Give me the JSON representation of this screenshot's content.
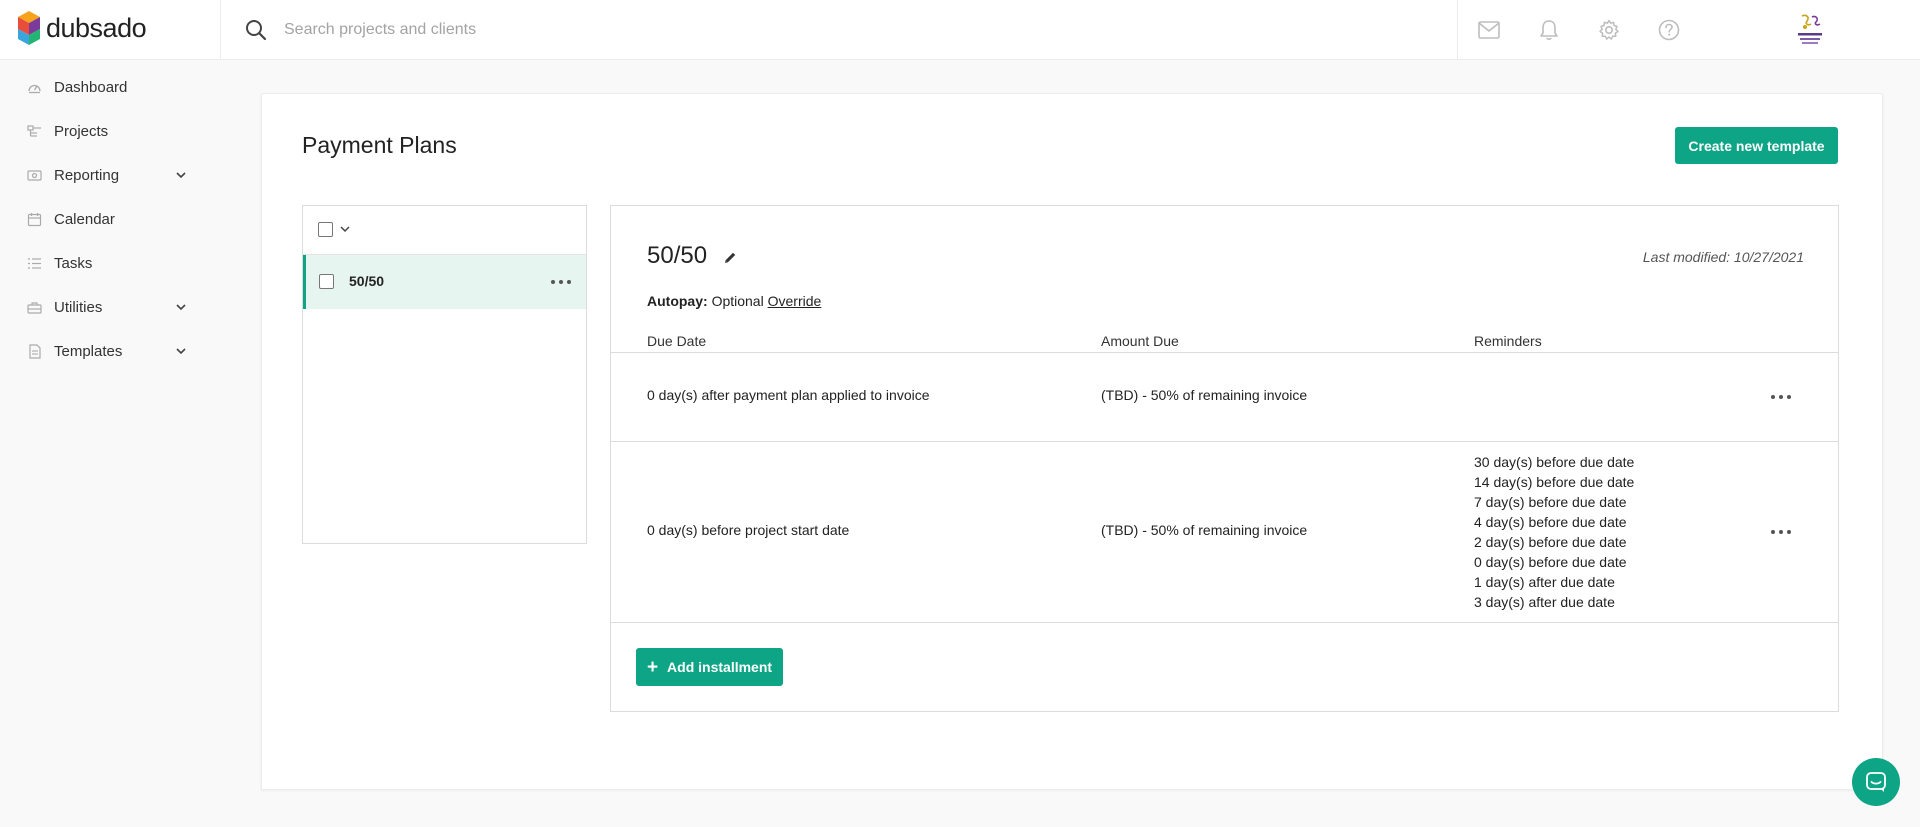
{
  "brand": {
    "name": "dubsado",
    "accent_color": "#0ea486"
  },
  "topbar": {
    "search_placeholder": "Search projects and clients",
    "icons": [
      "search-icon",
      "mail-icon",
      "bell-icon",
      "gear-icon",
      "help-icon"
    ],
    "avatar_icon": "studio-logo-avatar"
  },
  "sidebar": {
    "items": [
      {
        "label": "Dashboard",
        "icon": "dashboard-icon",
        "has_chevron": false
      },
      {
        "label": "Projects",
        "icon": "projects-icon",
        "has_chevron": false
      },
      {
        "label": "Reporting",
        "icon": "reporting-icon",
        "has_chevron": true
      },
      {
        "label": "Calendar",
        "icon": "calendar-icon",
        "has_chevron": false
      },
      {
        "label": "Tasks",
        "icon": "tasks-icon",
        "has_chevron": false
      },
      {
        "label": "Utilities",
        "icon": "utilities-icon",
        "has_chevron": true
      },
      {
        "label": "Templates",
        "icon": "templates-icon",
        "has_chevron": true
      }
    ]
  },
  "main": {
    "title": "Payment Plans",
    "create_button": "Create new template",
    "plans": [
      {
        "label": "50/50",
        "selected": true
      }
    ],
    "detail": {
      "name": "50/50",
      "last_modified": "Last modified: 10/27/2021",
      "autopay_label": "Autopay:",
      "autopay_value": "Optional",
      "override_link": "Override",
      "columns": [
        "Due Date",
        "Amount Due",
        "Reminders"
      ],
      "installments": [
        {
          "due_date": "0 day(s) after payment plan applied to invoice",
          "amount_due": "(TBD) - 50% of remaining invoice",
          "reminders": []
        },
        {
          "due_date": "0 day(s) before project start date",
          "amount_due": "(TBD) - 50% of remaining invoice",
          "reminders": [
            "30 day(s) before due date",
            "14 day(s) before due date",
            "7 day(s) before due date",
            "4 day(s) before due date",
            "2 day(s) before due date",
            "0 day(s) before due date",
            "1 day(s) after due date",
            "3 day(s) after due date"
          ]
        }
      ],
      "add_button": "Add installment"
    }
  },
  "chat": {
    "icon": "chat-icon"
  }
}
